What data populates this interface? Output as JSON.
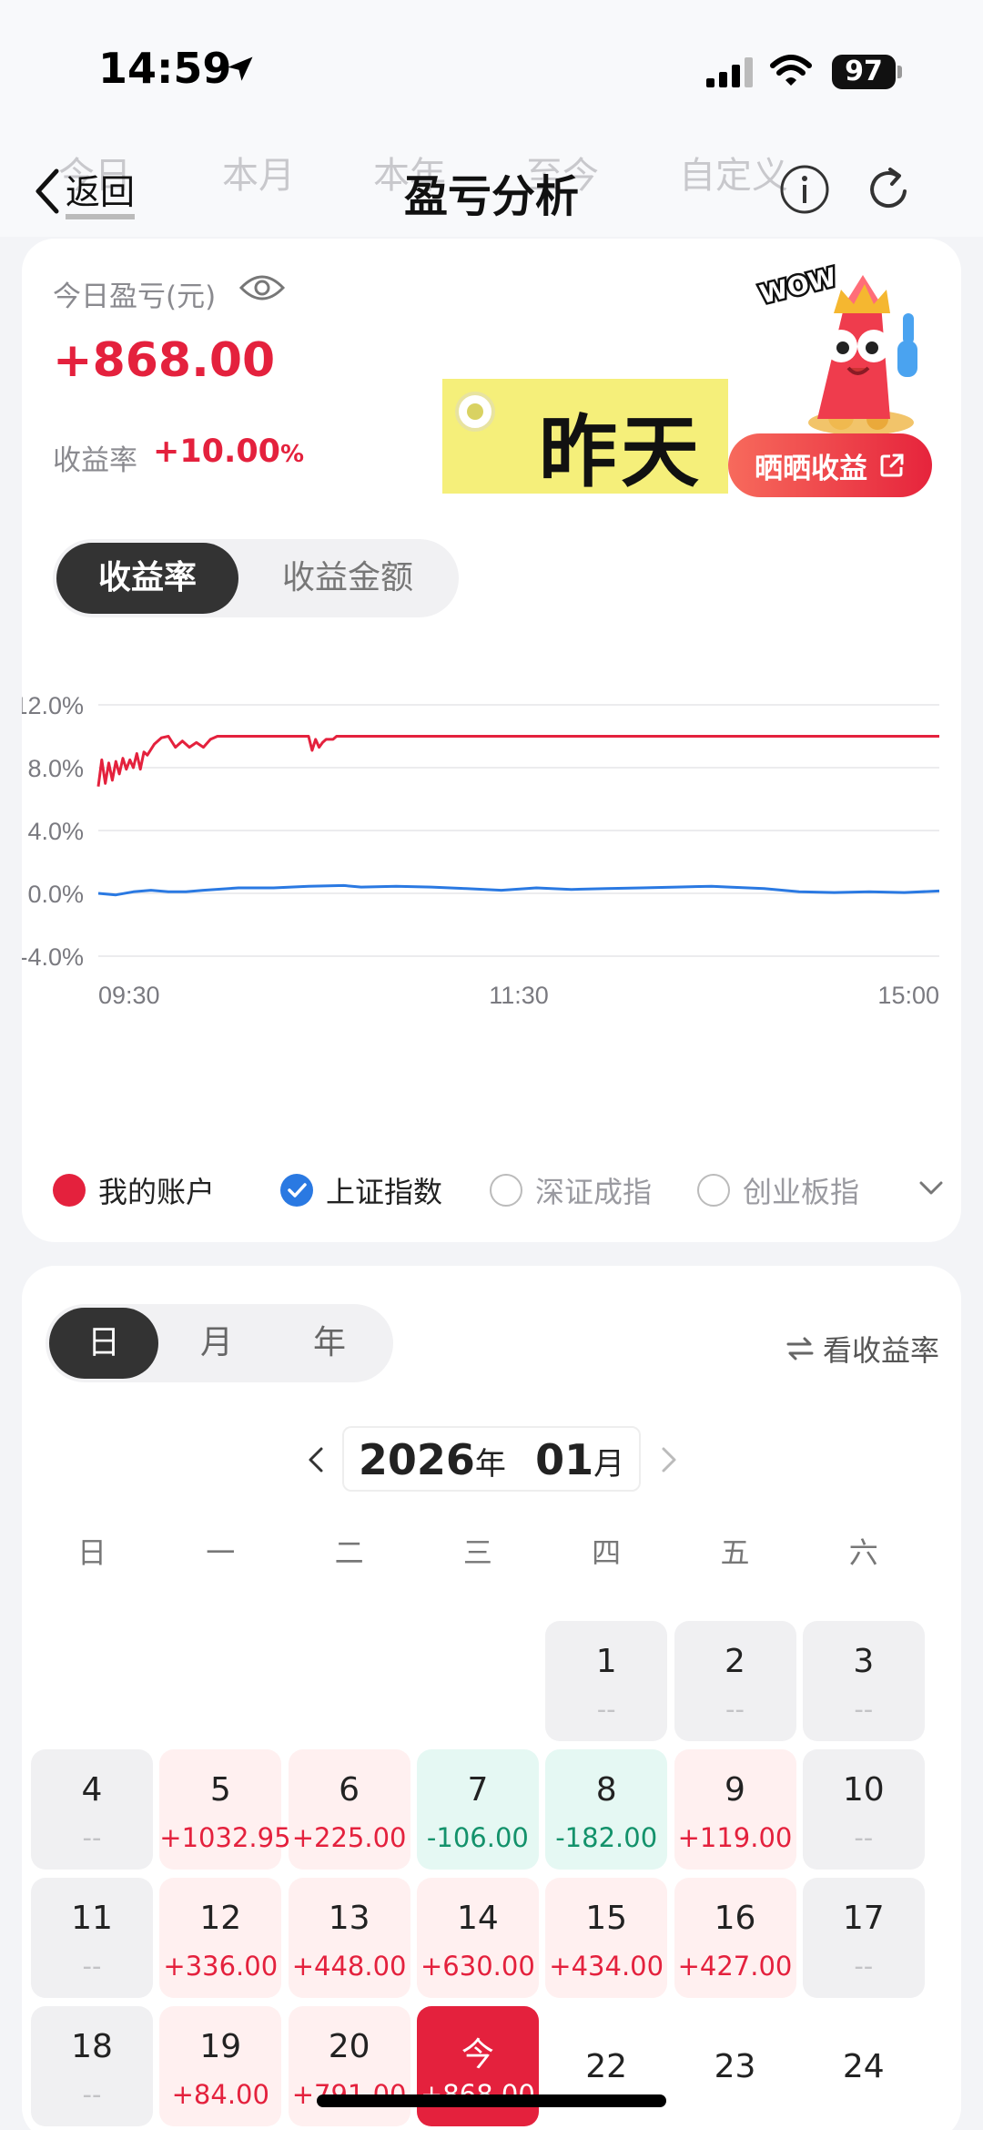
{
  "status": {
    "time": "14:59",
    "battery": "97"
  },
  "nav": {
    "ghost_tabs": [
      "今日",
      "本月",
      "本年",
      "至今",
      "自定义"
    ],
    "back_label": "返回",
    "title": "盈亏分析"
  },
  "summary": {
    "pl_label": "今日盈亏(元)",
    "pl_value": "+868.00",
    "rate_label": "收益率",
    "rate_value": "+10.00",
    "rate_unit": "%",
    "overlay_text": "昨天",
    "badge_text": "WOW",
    "share_label": "晒晒收益"
  },
  "chart_toggle": {
    "active": "收益率",
    "other": "收益金额"
  },
  "chart_data": {
    "type": "line",
    "x_ticks": [
      "09:30",
      "11:30",
      "15:00"
    ],
    "y_ticks": [
      "12.0%",
      "8.0%",
      "4.0%",
      "0.0%",
      "-4.0%"
    ],
    "ylim": [
      -4,
      12
    ],
    "x_range": [
      0,
      240
    ],
    "grid": true,
    "series": [
      {
        "name": "我的账户",
        "color": "#e4213d",
        "points": [
          [
            0,
            6.8
          ],
          [
            1,
            8.5
          ],
          [
            2,
            7.0
          ],
          [
            3,
            8.3
          ],
          [
            4,
            7.2
          ],
          [
            5,
            8.4
          ],
          [
            6,
            7.6
          ],
          [
            7,
            8.6
          ],
          [
            8,
            7.9
          ],
          [
            9,
            8.5
          ],
          [
            10,
            8.0
          ],
          [
            11,
            8.9
          ],
          [
            12,
            7.9
          ],
          [
            13,
            9.0
          ],
          [
            14,
            8.8
          ],
          [
            16,
            9.5
          ],
          [
            18,
            9.9
          ],
          [
            20,
            10.0
          ],
          [
            22,
            9.3
          ],
          [
            24,
            9.7
          ],
          [
            26,
            9.3
          ],
          [
            28,
            9.6
          ],
          [
            30,
            9.3
          ],
          [
            32,
            9.8
          ],
          [
            34,
            10.0
          ],
          [
            50,
            10.0
          ],
          [
            60,
            10.0
          ],
          [
            61,
            9.1
          ],
          [
            62,
            9.8
          ],
          [
            63,
            9.3
          ],
          [
            64,
            9.6
          ],
          [
            65,
            9.8
          ],
          [
            67,
            9.8
          ],
          [
            68,
            10.0
          ],
          [
            120,
            10.0
          ],
          [
            180,
            10.0
          ],
          [
            240,
            10.0
          ]
        ]
      },
      {
        "name": "上证指数",
        "color": "#2a79e2",
        "points": [
          [
            0,
            0.0
          ],
          [
            5,
            -0.1
          ],
          [
            10,
            0.1
          ],
          [
            15,
            0.2
          ],
          [
            20,
            0.1
          ],
          [
            25,
            0.1
          ],
          [
            30,
            0.2
          ],
          [
            40,
            0.35
          ],
          [
            50,
            0.35
          ],
          [
            60,
            0.45
          ],
          [
            70,
            0.5
          ],
          [
            75,
            0.4
          ],
          [
            85,
            0.45
          ],
          [
            95,
            0.4
          ],
          [
            105,
            0.3
          ],
          [
            115,
            0.2
          ],
          [
            125,
            0.35
          ],
          [
            135,
            0.25
          ],
          [
            145,
            0.3
          ],
          [
            155,
            0.35
          ],
          [
            165,
            0.4
          ],
          [
            175,
            0.45
          ],
          [
            180,
            0.4
          ],
          [
            190,
            0.3
          ],
          [
            200,
            0.1
          ],
          [
            210,
            0.05
          ],
          [
            220,
            0.1
          ],
          [
            230,
            0.05
          ],
          [
            240,
            0.15
          ]
        ]
      }
    ]
  },
  "legend": [
    {
      "label": "我的账户",
      "state": "filled",
      "color": "#e4213d"
    },
    {
      "label": "上证指数",
      "state": "checked",
      "color": "#2a79e2"
    },
    {
      "label": "深证成指",
      "state": "empty",
      "color": "#bbbbbb"
    },
    {
      "label": "创业板指",
      "state": "empty",
      "color": "#bbbbbb"
    }
  ],
  "calendar": {
    "period_tabs": [
      "日",
      "月",
      "年"
    ],
    "toggle_label": "看收益率",
    "year": "2026",
    "year_unit": "年",
    "month": "01",
    "month_unit": "月",
    "weekdays": [
      "日",
      "一",
      "二",
      "三",
      "四",
      "五",
      "六"
    ],
    "days": [
      {
        "day": "1",
        "amount": "--",
        "style": "gray"
      },
      {
        "day": "2",
        "amount": "--",
        "style": "gray"
      },
      {
        "day": "3",
        "amount": "--",
        "style": "gray"
      },
      {
        "day": "4",
        "amount": "--",
        "style": "gray"
      },
      {
        "day": "5",
        "amount": "+1032.95",
        "style": "red"
      },
      {
        "day": "6",
        "amount": "+225.00",
        "style": "red"
      },
      {
        "day": "7",
        "amount": "-106.00",
        "style": "green"
      },
      {
        "day": "8",
        "amount": "-182.00",
        "style": "green"
      },
      {
        "day": "9",
        "amount": "+119.00",
        "style": "red"
      },
      {
        "day": "10",
        "amount": "--",
        "style": "gray"
      },
      {
        "day": "11",
        "amount": "--",
        "style": "gray"
      },
      {
        "day": "12",
        "amount": "+336.00",
        "style": "red"
      },
      {
        "day": "13",
        "amount": "+448.00",
        "style": "red"
      },
      {
        "day": "14",
        "amount": "+630.00",
        "style": "red"
      },
      {
        "day": "15",
        "amount": "+434.00",
        "style": "red"
      },
      {
        "day": "16",
        "amount": "+427.00",
        "style": "red"
      },
      {
        "day": "17",
        "amount": "--",
        "style": "gray"
      },
      {
        "day": "18",
        "amount": "--",
        "style": "gray"
      },
      {
        "day": "19",
        "amount": "+84.00",
        "style": "red"
      },
      {
        "day": "20",
        "amount": "+791.00",
        "style": "red"
      },
      {
        "day": "今",
        "amount": "+868.00",
        "style": "today"
      },
      {
        "day": "22",
        "amount": "",
        "style": "plain"
      },
      {
        "day": "23",
        "amount": "",
        "style": "plain"
      },
      {
        "day": "24",
        "amount": "",
        "style": "plain"
      }
    ]
  }
}
